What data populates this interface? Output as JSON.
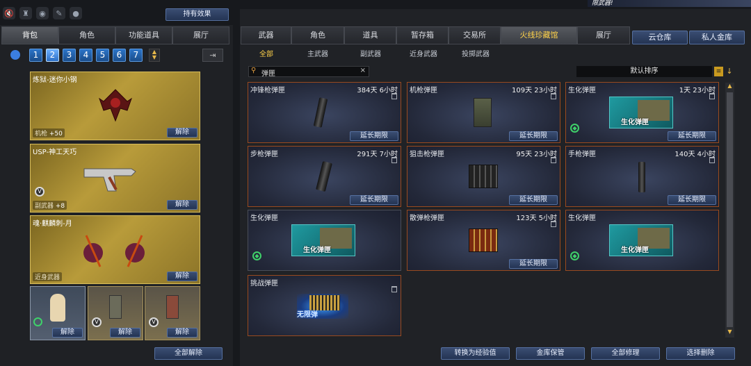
{
  "left_panel": {
    "holding_effect_label": "持有效果",
    "tabs": [
      "背包",
      "角色",
      "功能道具",
      "展厅"
    ],
    "pages": [
      "1",
      "2",
      "3",
      "4",
      "5",
      "6",
      "7"
    ],
    "selected_page": "2",
    "items": [
      {
        "name": "炼狱-迷你小钢",
        "tag": "机枪",
        "bonus": "+50",
        "action": "解除"
      },
      {
        "name": "USP-神工天巧",
        "tag": "副武器",
        "bonus": "+8",
        "action": "解除"
      },
      {
        "name": "魂·麒麟刺-月",
        "tag": "近身武器",
        "action": "解除"
      }
    ],
    "small_items": [
      {
        "action": "解除"
      },
      {
        "action": "解除"
      },
      {
        "action": "解除"
      }
    ],
    "remove_all_label": "全部解除"
  },
  "right_panel": {
    "banner_text": "限武器!",
    "tabs": [
      "武器",
      "角色",
      "道具",
      "暂存箱",
      "交易所",
      "火线珍藏馆",
      "展厅"
    ],
    "active_tab": "火线珍藏馆",
    "side_tabs": [
      "云仓库",
      "私人金库"
    ],
    "subtabs": [
      "全部",
      "主武器",
      "副武器",
      "近身武器",
      "投掷武器"
    ],
    "active_subtab": "全部",
    "search": {
      "value": "弹匣",
      "clear": "×"
    },
    "sort_label": "默认排序",
    "cards": [
      {
        "name": "冲锋枪弹匣",
        "time": "384天 6小时",
        "action": "延长期限"
      },
      {
        "name": "机枪弹匣",
        "time": "109天 23小时",
        "action": "延长期限"
      },
      {
        "name": "生化弹匣",
        "time": "1天 23小时",
        "action": "延长期限",
        "art_text": "生化弹匣"
      },
      {
        "name": "步枪弹匣",
        "time": "291天 7小时",
        "action": "延长期限"
      },
      {
        "name": "狙击枪弹匣",
        "time": "95天 23小时",
        "action": "延长期限"
      },
      {
        "name": "手枪弹匣",
        "time": "140天 4小时",
        "action": "延长期限"
      },
      {
        "name": "生化弹匣",
        "time": "",
        "art_text": "生化弹匣"
      },
      {
        "name": "散弹枪弹匣",
        "time": "123天 5小时",
        "action": "延长期限"
      },
      {
        "name": "生化弹匣",
        "time": "",
        "art_text": "生化弹匣"
      },
      {
        "name": "挑战弹匣",
        "time": "",
        "art_text": "无限弹"
      }
    ],
    "bottom_buttons": [
      "转换为经验值",
      "金库保管",
      "全部修理",
      "选择删除"
    ]
  },
  "colors": {
    "accent": "#ffd24a",
    "gold": "#b89b3a",
    "selection_border": "#9a4a1e",
    "button_blue": "#2e4167"
  }
}
